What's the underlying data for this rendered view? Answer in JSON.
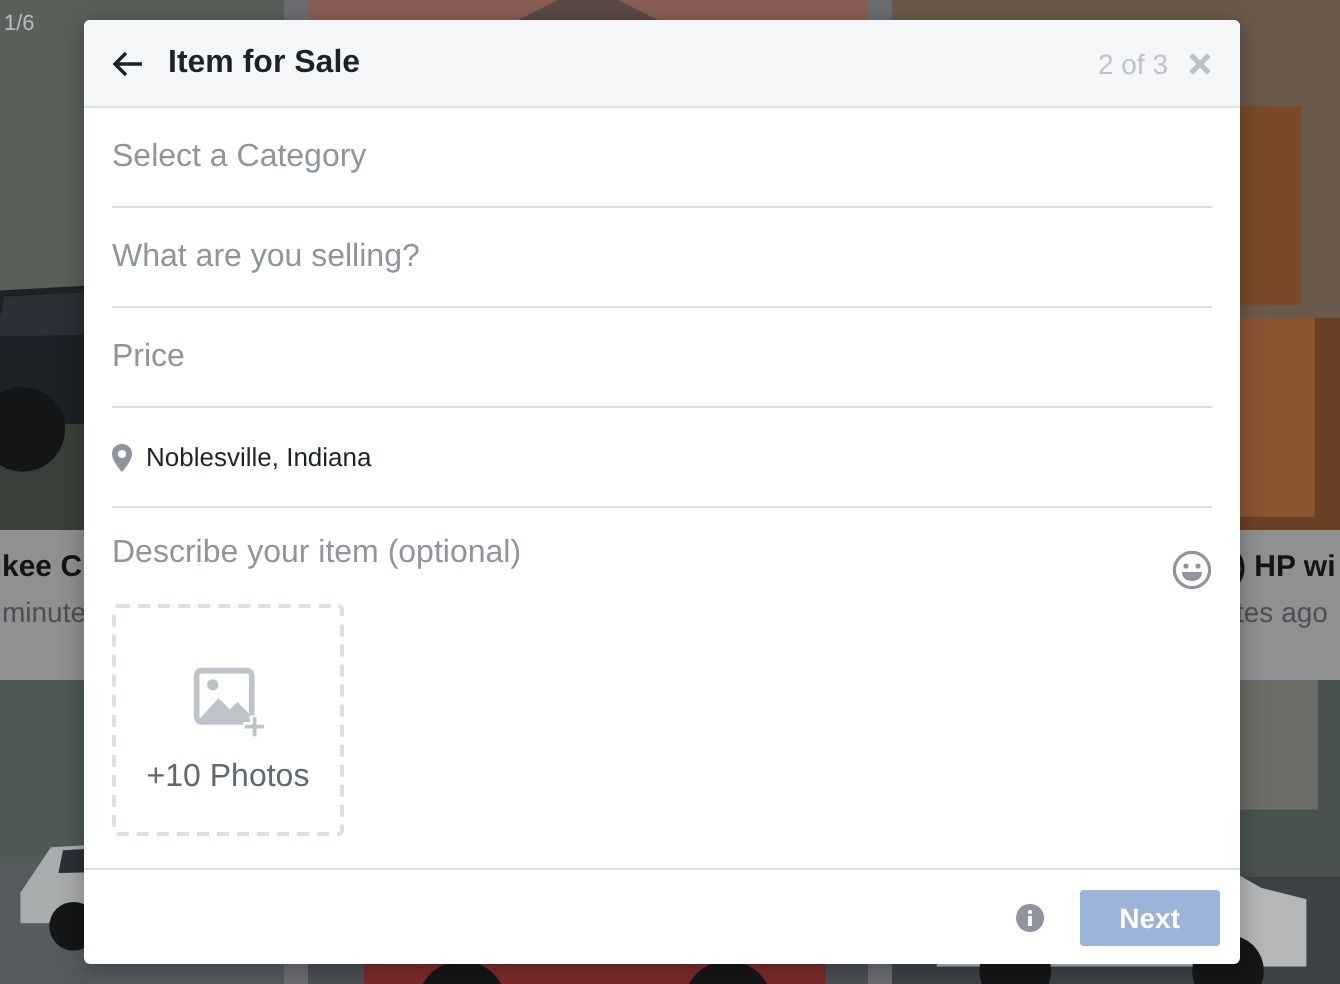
{
  "background": {
    "counter": "1/6",
    "cards": [
      {
        "title": "kee C",
        "subtitle": "minute"
      },
      {
        "title": ") HP wi",
        "subtitle": "tes ago"
      }
    ]
  },
  "dialog": {
    "title": "Item for Sale",
    "step": "2 of 3",
    "fields": [
      {
        "kind": "input",
        "placeholder": "Select a Category"
      },
      {
        "kind": "input",
        "placeholder": "What are you selling?"
      },
      {
        "kind": "input",
        "placeholder": "Price"
      },
      {
        "kind": "location",
        "value": "Noblesville, Indiana"
      }
    ],
    "description": {
      "placeholder": "Describe your item (optional)"
    },
    "photos": {
      "label": "+10 Photos"
    },
    "next": {
      "label": "Next",
      "disabled": true
    }
  }
}
